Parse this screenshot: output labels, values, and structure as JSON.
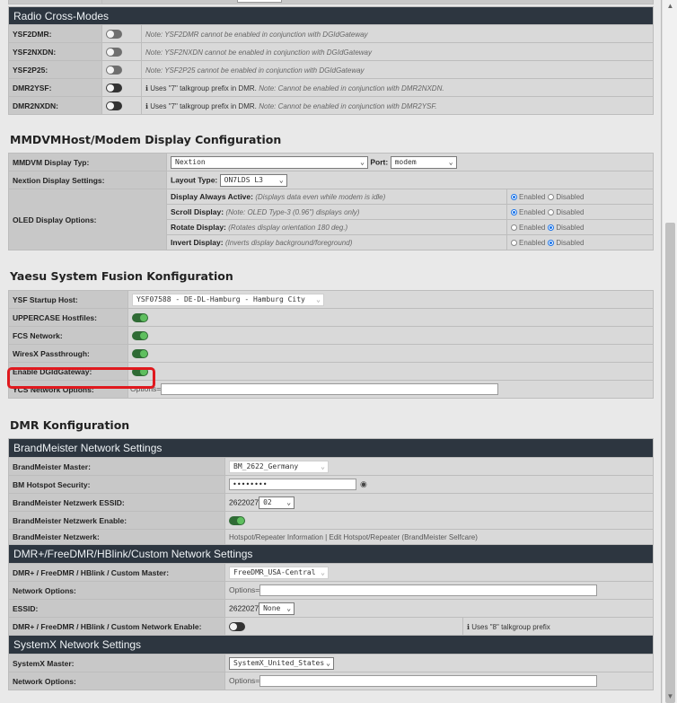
{
  "radio_cross_modes": {
    "header": "Radio Cross-Modes",
    "rows": [
      {
        "label": "YSF2DMR:",
        "note": "Note: YSF2DMR cannot be enabled in conjunction with DGIdGateway"
      },
      {
        "label": "YSF2NXDN:",
        "note": "Note: YSF2NXDN cannot be enabled in conjunction with DGIdGateway"
      },
      {
        "label": "YSF2P25:",
        "note": "Note: YSF2P25 cannot be enabled in conjunction with DGIdGateway"
      },
      {
        "label": "DMR2YSF:",
        "info": "Uses \"7\" talkgroup prefix in DMR.",
        "note": "Note: Cannot be enabled in conjunction with DMR2NXDN."
      },
      {
        "label": "DMR2NXDN:",
        "info": "Uses \"7\" talkgroup prefix in DMR.",
        "note": "Note: Cannot be enabled in conjunction with DMR2YSF."
      }
    ]
  },
  "display_config": {
    "title": "MMDVMHost/Modem Display Configuration",
    "display_type_label": "MMDVM Display Typ:",
    "display_type_value": "Nextion",
    "port_label": "Port:",
    "port_value": "modem",
    "nextion_label": "Nextion Display Settings:",
    "layout_label": "Layout Type:",
    "layout_value": "ON7LDS L3",
    "oled_label": "OLED Display Options:",
    "oled_options": [
      {
        "name": "Display Always Active:",
        "hint": "(Displays data even while modem is idle)",
        "enabled": "Enabled",
        "disabled": "Disabled",
        "selected": "enabled"
      },
      {
        "name": "Scroll Display:",
        "hint": "(Note: OLED Type-3 (0.96\") displays only)",
        "enabled": "Enabled",
        "disabled": "Disabled",
        "selected": "enabled"
      },
      {
        "name": "Rotate Display:",
        "hint": "(Rotates display orientation 180 deg.)",
        "enabled": "Enabled",
        "disabled": "Disabled",
        "selected": "disabled"
      },
      {
        "name": "Invert Display:",
        "hint": "(Inverts display background/foreground)",
        "enabled": "Enabled",
        "disabled": "Disabled",
        "selected": "disabled"
      }
    ]
  },
  "ysf": {
    "title": "Yaesu System Fusion Konfiguration",
    "startup_label": "YSF Startup Host:",
    "startup_value": "YSF07588 - DE-DL-Hamburg - Hamburg City",
    "uppercase_label": "UPPERCASE Hostfiles:",
    "fcs_label": "FCS Network:",
    "wiresx_label": "WiresX Passthrough:",
    "dgid_label": "Enable DGIdGateway:",
    "ycs_label": "YCS Network Options:",
    "ycs_prefix": "Options="
  },
  "dmr": {
    "title": "DMR Konfiguration",
    "bm_header": "BrandMeister Network Settings",
    "bm_master_label": "BrandMeister Master:",
    "bm_master_value": "BM_2622_Germany",
    "bm_security_label": "BM Hotspot Security:",
    "bm_security_value": "••••••••",
    "bm_essid_label": "BrandMeister Netzwerk ESSID:",
    "bm_essid_prefix": "2622027",
    "bm_essid_value": "02",
    "bm_enable_label": "BrandMeister Netzwerk Enable:",
    "bm_network_label": "BrandMeister Netzwerk:",
    "bm_link_1": "Hotspot/Repeater Information",
    "bm_link_sep": " | ",
    "bm_link_2": "Edit Hotspot/Repeater (BrandMeister Selfcare)",
    "dmrplus_header": "DMR+/FreeDMR/HBlink/Custom Network Settings",
    "dmrplus_master_label": "DMR+ / FreeDMR / HBlink / Custom Master:",
    "dmrplus_master_value": "FreeDMR_USA-Central",
    "netopt_label": "Network Options:",
    "netopt_prefix": "Options=",
    "essid_label": "ESSID:",
    "essid_prefix": "2622027",
    "essid_value": "None",
    "dmrplus_enable_label": "DMR+ / FreeDMR / HBlink / Custom Network Enable:",
    "dmrplus_info": "Uses \"8\" talkgroup prefix",
    "systemx_header": "SystemX Network Settings",
    "systemx_master_label": "SystemX Master:",
    "systemx_master_value": "SystemX_United_States",
    "systemx_netopt_label": "Network Options:",
    "systemx_netopt_prefix": "Options="
  },
  "colors": {
    "header_bg": "#2d3640",
    "highlight": "#e0191e",
    "toggle_on": "#2f6b35"
  }
}
